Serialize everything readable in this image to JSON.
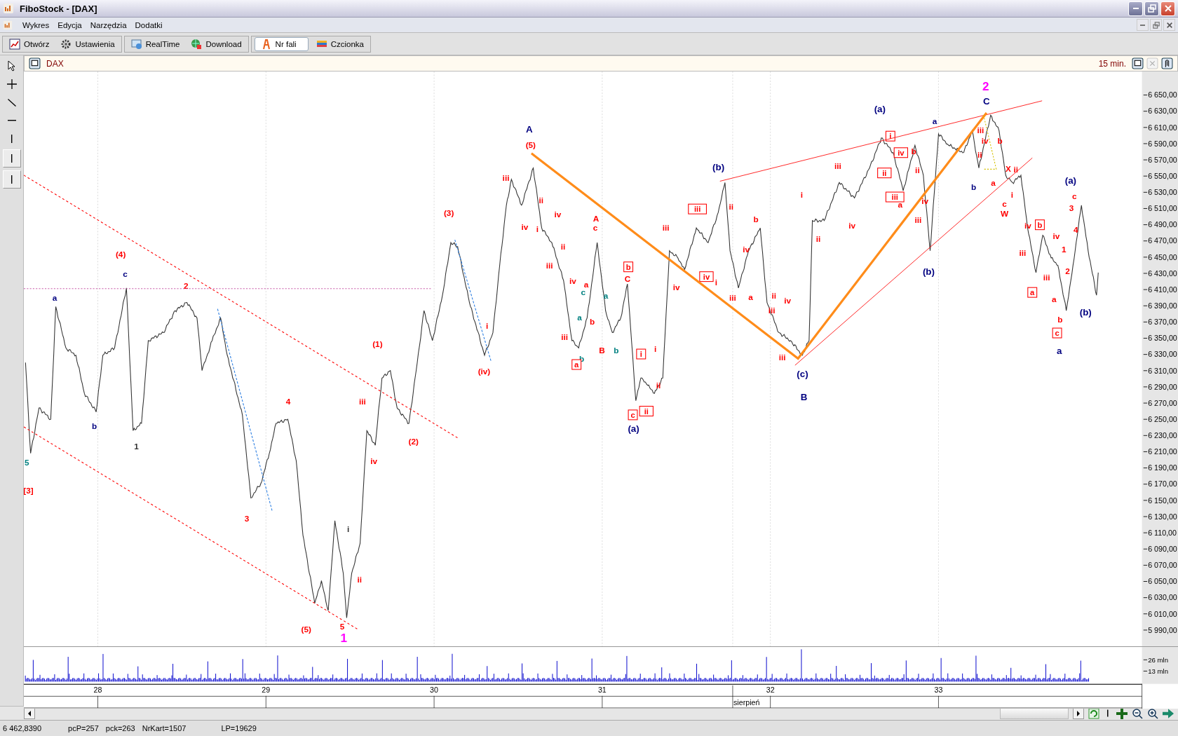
{
  "window": {
    "title": "FiboStock - [DAX]"
  },
  "menu": [
    "Wykres",
    "Edycja",
    "Narzędzia",
    "Dodatki"
  ],
  "toolbar_groups": [
    {
      "buttons": [
        {
          "label": "Otwórz",
          "kind": "open",
          "selected": false
        },
        {
          "label": "Ustawienia",
          "kind": "settings",
          "selected": false
        }
      ]
    },
    {
      "buttons": [
        {
          "label": "RealTime",
          "kind": "realtime",
          "selected": false
        },
        {
          "label": "Download",
          "kind": "download",
          "selected": false
        }
      ]
    },
    {
      "buttons": [
        {
          "label": "Nr fali",
          "kind": "wave",
          "selected": true
        },
        {
          "label": "Czcionka",
          "kind": "font",
          "selected": false
        }
      ]
    }
  ],
  "chart": {
    "symbol": "DAX",
    "interval": "15 min.",
    "chart_data": {
      "type": "line",
      "grid": true,
      "xlim": [
        27.56,
        34.21
      ],
      "ylim": [
        5970,
        6679
      ],
      "x": [
        27.57,
        27.6,
        27.65,
        27.72,
        27.75,
        27.81,
        27.87,
        27.92,
        27.99,
        28.03,
        28.1,
        28.17,
        28.21,
        28.26,
        28.3,
        28.39,
        28.46,
        28.53,
        28.59,
        28.62,
        28.68,
        28.73,
        28.77,
        28.86,
        28.91,
        28.97,
        29.02,
        29.06,
        29.13,
        29.18,
        29.22,
        29.29,
        29.33,
        29.37,
        29.41,
        29.46,
        29.48,
        29.51,
        29.56,
        29.6,
        29.65,
        29.69,
        29.74,
        29.78,
        29.85,
        29.9,
        29.94,
        29.99,
        30.05,
        30.1,
        30.14,
        30.21,
        30.3,
        30.35,
        30.39,
        30.43,
        30.46,
        30.52,
        30.59,
        30.64,
        30.7,
        30.77,
        30.82,
        30.86,
        30.91,
        30.97,
        31.02,
        31.06,
        31.11,
        31.15,
        31.2,
        31.23,
        31.27,
        31.31,
        31.36,
        31.4,
        31.45,
        31.49,
        31.56,
        31.63,
        31.69,
        31.73,
        31.76,
        31.81,
        31.87,
        31.94,
        31.98,
        32.05,
        32.12,
        32.19,
        32.23,
        32.25,
        32.32,
        32.41,
        32.5,
        32.59,
        32.66,
        32.73,
        32.79,
        32.86,
        32.91,
        32.95,
        33.0,
        33.06,
        33.15,
        33.2,
        33.24,
        33.31,
        33.36,
        33.4,
        33.44,
        33.49,
        33.53,
        33.58,
        33.62,
        33.67,
        33.71,
        33.76,
        33.8,
        33.85,
        33.89,
        33.94,
        33.95
      ],
      "series": [
        {
          "color": "#333333",
          "values": [
            6320,
            6208,
            6264,
            6250,
            6389,
            6338,
            6329,
            6282,
            6259,
            6329,
            6338,
            6412,
            6236,
            6245,
            6347,
            6357,
            6384,
            6394,
            6375,
            6310,
            6347,
            6375,
            6329,
            6255,
            6153,
            6171,
            6208,
            6245,
            6250,
            6199,
            6107,
            6023,
            6051,
            6014,
            6125,
            6060,
            6005,
            6060,
            6097,
            6236,
            6218,
            6301,
            6310,
            6264,
            6245,
            6320,
            6384,
            6347,
            6403,
            6468,
            6463,
            6394,
            6329,
            6357,
            6440,
            6514,
            6546,
            6514,
            6560,
            6486,
            6468,
            6421,
            6347,
            6338,
            6375,
            6468,
            6384,
            6357,
            6375,
            6417,
            6273,
            6301,
            6292,
            6282,
            6301,
            6458,
            6449,
            6435,
            6486,
            6468,
            6505,
            6542,
            6458,
            6412,
            6458,
            6486,
            6394,
            6357,
            6347,
            6329,
            6347,
            6495,
            6495,
            6542,
            6523,
            6560,
            6597,
            6579,
            6532,
            6588,
            6551,
            6458,
            6602,
            6588,
            6579,
            6606,
            6560,
            6625,
            6606,
            6551,
            6542,
            6551,
            6486,
            6431,
            6477,
            6449,
            6440,
            6384,
            6440,
            6514,
            6458,
            6403,
            6431
          ]
        }
      ],
      "xticks": [
        {
          "value": 28,
          "label": "28"
        },
        {
          "value": 29,
          "label": "29"
        },
        {
          "value": 30,
          "label": "30"
        },
        {
          "value": 31,
          "label": "31"
        },
        {
          "value": 32,
          "label": "32"
        },
        {
          "value": 33,
          "label": "33"
        }
      ],
      "yticks": [
        {
          "value": 6650,
          "label": "6 650,00"
        },
        {
          "value": 6630,
          "label": "6 630,00"
        },
        {
          "value": 6610,
          "label": "6 610,00"
        },
        {
          "value": 6590,
          "label": "6 590,00"
        },
        {
          "value": 6570,
          "label": "6 570,00"
        },
        {
          "value": 6550,
          "label": "6 550,00"
        },
        {
          "value": 6530,
          "label": "6 530,00"
        },
        {
          "value": 6510,
          "label": "6 510,00"
        },
        {
          "value": 6490,
          "label": "6 490,00"
        },
        {
          "value": 6470,
          "label": "6 470,00"
        },
        {
          "value": 6450,
          "label": "6 450,00"
        },
        {
          "value": 6430,
          "label": "6 430,00"
        },
        {
          "value": 6410,
          "label": "6 410,00"
        },
        {
          "value": 6390,
          "label": "6 390,00"
        },
        {
          "value": 6370,
          "label": "6 370,00"
        },
        {
          "value": 6350,
          "label": "6 350,00"
        },
        {
          "value": 6330,
          "label": "6 330,00"
        },
        {
          "value": 6310,
          "label": "6 310,00"
        },
        {
          "value": 6290,
          "label": "6 290,00"
        },
        {
          "value": 6270,
          "label": "6 270,00"
        },
        {
          "value": 6250,
          "label": "6 250,00"
        },
        {
          "value": 6230,
          "label": "6 230,00"
        },
        {
          "value": 6210,
          "label": "6 210,00"
        },
        {
          "value": 6190,
          "label": "6 190,00"
        },
        {
          "value": 6170,
          "label": "6 170,00"
        },
        {
          "value": 6150,
          "label": "6 150,00"
        },
        {
          "value": 6130,
          "label": "6 130,00"
        },
        {
          "value": 6110,
          "label": "6 110,00"
        },
        {
          "value": 6090,
          "label": "6 090,00"
        },
        {
          "value": 6070,
          "label": "6 070,00"
        },
        {
          "value": 6050,
          "label": "6 050,00"
        },
        {
          "value": 6030,
          "label": "6 030,00"
        },
        {
          "value": 6010,
          "label": "6 010,00"
        },
        {
          "value": 5990,
          "label": "5 990,00"
        }
      ]
    },
    "volume_ticks": [
      "26 mln",
      "13 mln"
    ],
    "month": "sierpień",
    "wave_labels": [
      {
        "text": "5",
        "color": "#008080",
        "kind": "minor"
      },
      {
        "text": "[3]",
        "color": "#ff0000",
        "kind": "minor"
      },
      {
        "text": "a",
        "color": "#000080",
        "kind": "minor"
      },
      {
        "text": "b",
        "color": "#000080",
        "kind": "minor"
      },
      {
        "text": "c",
        "color": "#000080",
        "kind": "minor"
      },
      {
        "text": "(4)",
        "color": "#ff0000",
        "kind": "minor"
      },
      {
        "text": "1",
        "color": "#333333",
        "kind": "minor"
      },
      {
        "text": "2",
        "color": "#ff0000",
        "kind": "minor"
      },
      {
        "text": "4",
        "color": "#ff0000",
        "kind": "minor"
      },
      {
        "text": "3",
        "color": "#ff0000",
        "kind": "minor"
      },
      {
        "text": "(5)",
        "color": "#ff0000",
        "kind": "minor"
      },
      {
        "text": "5",
        "color": "#ff0000",
        "kind": "minor"
      },
      {
        "text": "1",
        "color": "#ff00ff",
        "kind": "primary"
      },
      {
        "text": "i",
        "color": "#333333",
        "kind": "minor"
      },
      {
        "text": "ii",
        "color": "#ff0000",
        "kind": "minor"
      },
      {
        "text": "iii",
        "color": "#ff0000",
        "kind": "minor"
      },
      {
        "text": "iv",
        "color": "#ff0000",
        "kind": "minor"
      },
      {
        "text": "(1)",
        "color": "#ff0000",
        "kind": "minor"
      },
      {
        "text": "(2)",
        "color": "#ff0000",
        "kind": "minor"
      },
      {
        "text": "(3)",
        "color": "#ff0000",
        "kind": "minor"
      },
      {
        "text": "(iv)",
        "color": "#ff0000",
        "kind": "minor"
      },
      {
        "text": "i",
        "color": "#ff0000",
        "kind": "minor"
      },
      {
        "text": "A",
        "color": "#000080",
        "kind": "major"
      },
      {
        "text": "(5)",
        "color": "#ff0000",
        "kind": "minor"
      },
      {
        "text": "iii",
        "color": "#ff0000",
        "kind": "minor"
      },
      {
        "text": "iv",
        "color": "#ff0000",
        "kind": "minor"
      },
      {
        "text": "ii",
        "color": "#ff0000",
        "kind": "minor"
      },
      {
        "text": "i",
        "color": "#ff0000",
        "kind": "minor"
      },
      {
        "text": "iv",
        "color": "#ff0000",
        "kind": "minor"
      },
      {
        "text": "ii",
        "color": "#ff0000",
        "kind": "minor"
      },
      {
        "text": "iii",
        "color": "#ff0000",
        "kind": "minor"
      },
      {
        "text": "iv",
        "color": "#ff0000",
        "kind": "minor"
      },
      {
        "text": "iii",
        "color": "#ff0000",
        "kind": "minor"
      },
      {
        "text": "a",
        "color": "#ff0000",
        "kind": "minor"
      },
      {
        "text": "A",
        "color": "#ff0000",
        "kind": "minor"
      },
      {
        "text": "c",
        "color": "#ff0000",
        "kind": "minor"
      },
      {
        "text": "a",
        "color": "#008080",
        "kind": "minor"
      },
      {
        "text": "c",
        "color": "#008080",
        "kind": "minor"
      },
      {
        "text": "b",
        "color": "#008080",
        "kind": "minor"
      },
      {
        "text": "b",
        "color": "#ff0000",
        "kind": "minor"
      },
      {
        "text": "a",
        "color": "#ff0000",
        "kind": "boxed"
      },
      {
        "text": "B",
        "color": "#ff0000",
        "kind": "minor"
      },
      {
        "text": "a",
        "color": "#008080",
        "kind": "minor"
      },
      {
        "text": "b",
        "color": "#008080",
        "kind": "minor"
      },
      {
        "text": "b",
        "color": "#ff0000",
        "kind": "boxed"
      },
      {
        "text": "C",
        "color": "#ff0000",
        "kind": "minor"
      },
      {
        "text": "i",
        "color": "#ff0000",
        "kind": "boxed"
      },
      {
        "text": "i",
        "color": "#ff0000",
        "kind": "minor"
      },
      {
        "text": "ii",
        "color": "#ff0000",
        "kind": "minor"
      },
      {
        "text": "ii",
        "color": "#ff0000",
        "kind": "boxed"
      },
      {
        "text": "c",
        "color": "#ff0000",
        "kind": "boxed"
      },
      {
        "text": "(a)",
        "color": "#000080",
        "kind": "major"
      },
      {
        "text": "iii",
        "color": "#ff0000",
        "kind": "minor"
      },
      {
        "text": "iv",
        "color": "#ff0000",
        "kind": "minor"
      },
      {
        "text": "iii",
        "color": "#ff0000",
        "kind": "boxed"
      },
      {
        "text": "iv",
        "color": "#ff0000",
        "kind": "boxed"
      },
      {
        "text": "(b)",
        "color": "#000080",
        "kind": "major"
      },
      {
        "text": "ii",
        "color": "#ff0000",
        "kind": "minor"
      },
      {
        "text": "i",
        "color": "#ff0000",
        "kind": "minor"
      },
      {
        "text": "iii",
        "color": "#ff0000",
        "kind": "minor"
      },
      {
        "text": "iv",
        "color": "#ff0000",
        "kind": "minor"
      },
      {
        "text": "b",
        "color": "#ff0000",
        "kind": "minor"
      },
      {
        "text": "a",
        "color": "#ff0000",
        "kind": "minor"
      },
      {
        "text": "ii",
        "color": "#ff0000",
        "kind": "minor"
      },
      {
        "text": "iii",
        "color": "#ff0000",
        "kind": "minor"
      },
      {
        "text": "iv",
        "color": "#ff0000",
        "kind": "minor"
      },
      {
        "text": "iii",
        "color": "#ff0000",
        "kind": "minor"
      },
      {
        "text": "i",
        "color": "#ff0000",
        "kind": "minor"
      },
      {
        "text": "ii",
        "color": "#ff0000",
        "kind": "minor"
      },
      {
        "text": "iii",
        "color": "#ff0000",
        "kind": "minor"
      },
      {
        "text": "iv",
        "color": "#ff0000",
        "kind": "minor"
      },
      {
        "text": "(c)",
        "color": "#000080",
        "kind": "major"
      },
      {
        "text": "B",
        "color": "#000080",
        "kind": "major"
      },
      {
        "text": "(a)",
        "color": "#000080",
        "kind": "major"
      },
      {
        "text": "i",
        "color": "#ff0000",
        "kind": "boxed"
      },
      {
        "text": "ii",
        "color": "#ff0000",
        "kind": "boxed"
      },
      {
        "text": "iii",
        "color": "#ff0000",
        "kind": "boxed"
      },
      {
        "text": "iv",
        "color": "#ff0000",
        "kind": "boxed"
      },
      {
        "text": "b",
        "color": "#ff0000",
        "kind": "minor"
      },
      {
        "text": "a",
        "color": "#ff0000",
        "kind": "minor"
      },
      {
        "text": "ii",
        "color": "#ff0000",
        "kind": "minor"
      },
      {
        "text": "iv",
        "color": "#ff0000",
        "kind": "minor"
      },
      {
        "text": "iii",
        "color": "#ff0000",
        "kind": "minor"
      },
      {
        "text": "(b)",
        "color": "#000080",
        "kind": "major"
      },
      {
        "text": "a",
        "color": "#000080",
        "kind": "minor"
      },
      {
        "text": "2",
        "color": "#ff00ff",
        "kind": "primary"
      },
      {
        "text": "C",
        "color": "#000080",
        "kind": "major"
      },
      {
        "text": "b",
        "color": "#000080",
        "kind": "minor"
      },
      {
        "text": "ii",
        "color": "#ff0000",
        "kind": "minor"
      },
      {
        "text": "iii",
        "color": "#ff0000",
        "kind": "minor"
      },
      {
        "text": "iv",
        "color": "#ff0000",
        "kind": "minor"
      },
      {
        "text": "b",
        "color": "#ff0000",
        "kind": "minor"
      },
      {
        "text": "a",
        "color": "#ff0000",
        "kind": "minor"
      },
      {
        "text": "X",
        "color": "#ff0000",
        "kind": "minor"
      },
      {
        "text": "ii",
        "color": "#ff0000",
        "kind": "minor"
      },
      {
        "text": "i",
        "color": "#ff0000",
        "kind": "minor"
      },
      {
        "text": "c",
        "color": "#ff0000",
        "kind": "minor"
      },
      {
        "text": "W",
        "color": "#ff0000",
        "kind": "minor"
      },
      {
        "text": "iv",
        "color": "#ff0000",
        "kind": "minor"
      },
      {
        "text": "b",
        "color": "#ff0000",
        "kind": "boxed"
      },
      {
        "text": "iii",
        "color": "#ff0000",
        "kind": "minor"
      },
      {
        "text": "a",
        "color": "#ff0000",
        "kind": "boxed"
      },
      {
        "text": "iii",
        "color": "#ff0000",
        "kind": "minor"
      },
      {
        "text": "iv",
        "color": "#ff0000",
        "kind": "minor"
      },
      {
        "text": "c",
        "color": "#ff0000",
        "kind": "minor"
      },
      {
        "text": "3",
        "color": "#ff0000",
        "kind": "minor"
      },
      {
        "text": "4",
        "color": "#ff0000",
        "kind": "minor"
      },
      {
        "text": "1",
        "color": "#ff0000",
        "kind": "minor"
      },
      {
        "text": "2",
        "color": "#ff0000",
        "kind": "minor"
      },
      {
        "text": "a",
        "color": "#ff0000",
        "kind": "minor"
      },
      {
        "text": "b",
        "color": "#ff0000",
        "kind": "minor"
      },
      {
        "text": "c",
        "color": "#ff0000",
        "kind": "boxed"
      },
      {
        "text": "(a)",
        "color": "#000080",
        "kind": "major"
      },
      {
        "text": "(b)",
        "color": "#000080",
        "kind": "major"
      },
      {
        "text": "a",
        "color": "#000080",
        "kind": "major"
      }
    ]
  },
  "status_bar": [
    "6 462,8390",
    "pcP=257",
    "pck=263",
    "NrKart=1507",
    "LP=19629"
  ]
}
